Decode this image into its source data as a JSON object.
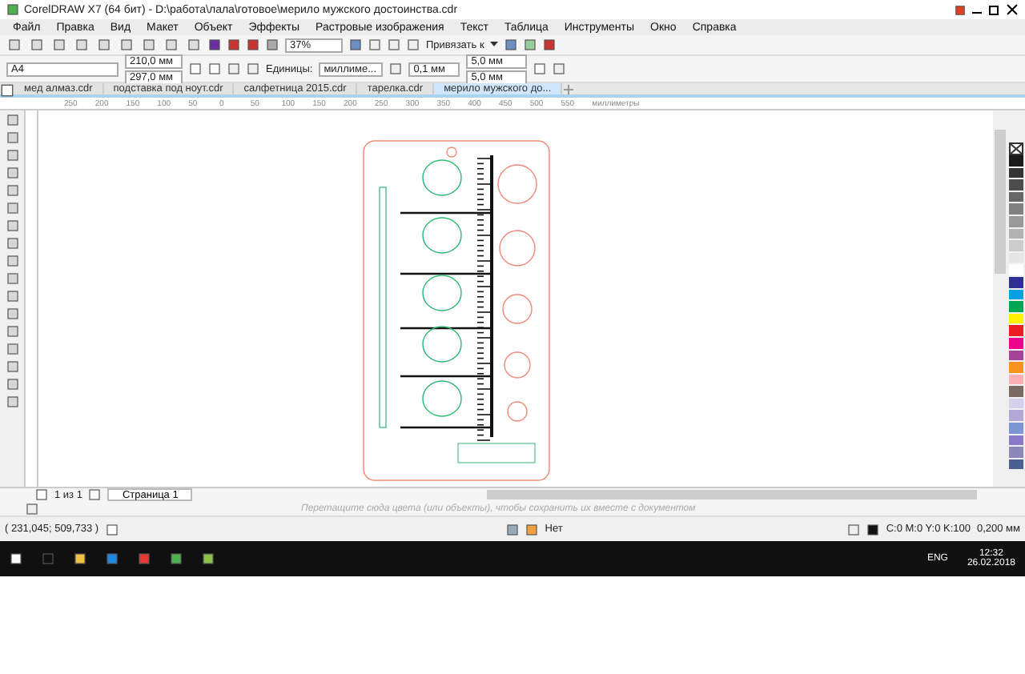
{
  "window": {
    "title": "CorelDRAW X7 (64 бит) - D:\\работа\\лала\\готовое\\мерило мужского достоинства.cdr"
  },
  "menu": [
    "Файл",
    "Правка",
    "Вид",
    "Макет",
    "Объект",
    "Эффекты",
    "Растровые изображения",
    "Текст",
    "Таблица",
    "Инструменты",
    "Окно",
    "Справка"
  ],
  "toolbar": {
    "zoom": "37%",
    "snap": "Привязать к"
  },
  "property_bar": {
    "page_size": "A4",
    "width": "210,0 мм",
    "height": "297,0 мм",
    "units_label": "Единицы:",
    "units": "миллиме...",
    "nudge": "0,1 мм",
    "dup_x": "5,0 мм",
    "dup_y": "5,0 мм"
  },
  "tabs": [
    {
      "label": "мед алмаз.cdr",
      "selected": false
    },
    {
      "label": "подставка под ноут.cdr",
      "selected": false
    },
    {
      "label": "салфетница 2015.cdr",
      "selected": false
    },
    {
      "label": "тарелка.cdr",
      "selected": false
    },
    {
      "label": "мерило мужского до...",
      "selected": true
    }
  ],
  "ruler": {
    "labels": [
      "250",
      "200",
      "150",
      "100",
      "50",
      "0",
      "50",
      "100",
      "150",
      "200",
      "250",
      "300",
      "350",
      "400",
      "450",
      "500",
      "550"
    ],
    "unit": "миллиметры"
  },
  "palette": [
    {
      "color": "#1a1a1a"
    },
    {
      "color": "#333333"
    },
    {
      "color": "#4d4d4d"
    },
    {
      "color": "#666666"
    },
    {
      "color": "#808080"
    },
    {
      "color": "#999999"
    },
    {
      "color": "#b3b3b3"
    },
    {
      "color": "#cccccc"
    },
    {
      "color": "#e6e6e6"
    },
    {
      "color": "#ffffff"
    },
    {
      "color": "#2e3192"
    },
    {
      "color": "#00a0e3"
    },
    {
      "color": "#00a651"
    },
    {
      "color": "#fff200"
    },
    {
      "color": "#ed1c24"
    },
    {
      "color": "#ec008c"
    },
    {
      "color": "#a54399"
    },
    {
      "color": "#f7941d"
    },
    {
      "color": "#f9b1b6"
    },
    {
      "color": "#7a6a62"
    },
    {
      "color": "#d4d0ee"
    },
    {
      "color": "#b4a7d6"
    },
    {
      "color": "#7b96d2"
    },
    {
      "color": "#8a78c8"
    },
    {
      "color": "#8c87b8"
    },
    {
      "color": "#4a6090"
    }
  ],
  "page_nav": {
    "count": "1 из 1",
    "page_tab": "Страница 1"
  },
  "color_docker_hint": "Перетащите сюда цвета (или объекты), чтобы сохранить их вместе с документом",
  "status_bar": {
    "coordinates": "( 231,045; 509,733 )",
    "fill": "Нет",
    "outline": "C:0 M:0 Y:0 K:100",
    "outline_width": "0,200 мм"
  },
  "taskbar": {
    "language": "ENG",
    "time": "12:32",
    "date": "26.02.2018"
  }
}
